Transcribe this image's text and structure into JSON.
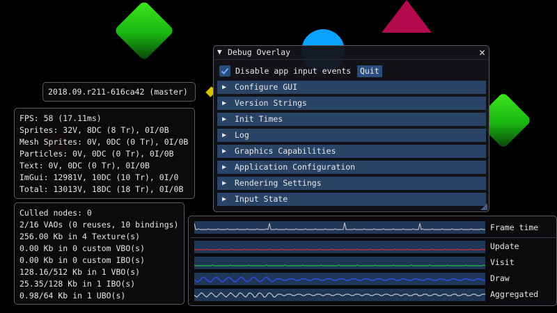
{
  "version": {
    "text": "2018.09.r211-616ca42 (master)"
  },
  "stats": [
    "FPS: 58 (17.11ms)",
    "Sprites: 32V, 8DC (8 Tr), 0I/0B",
    "Mesh Sprites: 0V, 0DC (0 Tr), 0I/0B",
    "Particles: 0V, 0DC (0 Tr), 0I/0B",
    "Text: 0V, 0DC (0 Tr), 0I/0B",
    "ImGui: 12981V, 10DC (10 Tr), 0I/0",
    "Total: 13013V, 18DC (18 Tr), 0I/0B"
  ],
  "memory": [
    "Culled nodes: 0",
    "2/16 VAOs (0 reuses, 10 bindings)",
    "256.00 Kb in 4 Texture(s)",
    "0.00 Kb in 0 custom VBO(s)",
    "0.00 Kb in 0 custom IBO(s)",
    "128.16/512 Kb in 1 VBO(s)",
    "25.35/128 Kb in 1 IBO(s)",
    "0.98/64 Kb in 1 UBO(s)"
  ],
  "overlay": {
    "title": "Debug Overlay",
    "close_glyph": "✕",
    "checkbox_label": "Disable app input events",
    "checkbox_checked": true,
    "quit_label": "Quit",
    "sections": [
      "Configure GUI",
      "Version Strings",
      "Init Times",
      "Log",
      "Graphics Capabilities",
      "Application Configuration",
      "Rendering Settings",
      "Input State"
    ]
  },
  "graphs": [
    {
      "label": "Frame time",
      "color": "#b8b8c0"
    },
    {
      "label": "Update",
      "color": "#e0303a"
    },
    {
      "label": "Visit",
      "color": "#22c24a"
    },
    {
      "label": "Draw",
      "color": "#2a4fe8"
    },
    {
      "label": "Aggregated",
      "color": "#c8c8cc"
    }
  ]
}
